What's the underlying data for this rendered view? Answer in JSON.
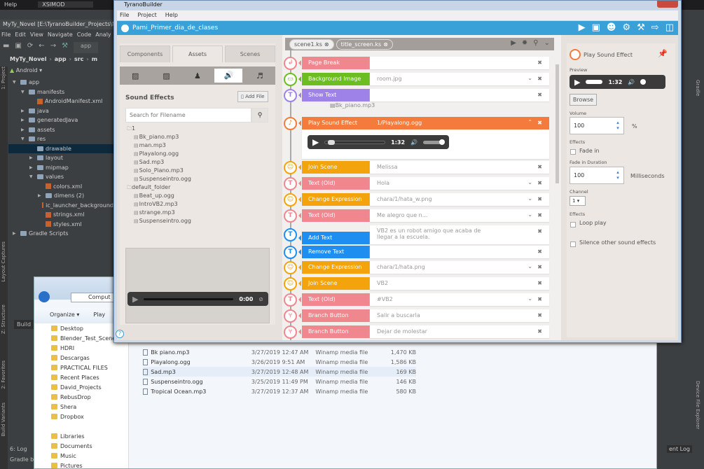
{
  "android_studio": {
    "top_menu": "Help",
    "top_tab": "XSIMOD",
    "title": "MyTy_Novel [E:\\TyranoBuilder_Projects\\M",
    "menu": [
      "File",
      "Edit",
      "View",
      "Navigate",
      "Code",
      "Analy"
    ],
    "run_config": "app",
    "breadcrumb": [
      "MyTy_Novel",
      "app",
      "src",
      "m"
    ],
    "view_selector": "Android",
    "side_tabs": [
      "1: Project",
      "Layout Captures",
      "Z: Structure",
      "2: Favorites",
      "Build Variants"
    ],
    "tree": [
      {
        "label": "app",
        "depth": 0,
        "arrow": "▼",
        "type": "folder"
      },
      {
        "label": "manifests",
        "depth": 1,
        "arrow": "▼",
        "type": "folder"
      },
      {
        "label": "AndroidManifest.xml",
        "depth": 2,
        "arrow": "",
        "type": "xml"
      },
      {
        "label": "java",
        "depth": 1,
        "arrow": "▶",
        "type": "folder"
      },
      {
        "label": "generatedJava",
        "depth": 1,
        "arrow": "▶",
        "type": "folder"
      },
      {
        "label": "assets",
        "depth": 1,
        "arrow": "▶",
        "type": "folder"
      },
      {
        "label": "res",
        "depth": 1,
        "arrow": "▼",
        "type": "folder"
      },
      {
        "label": "drawable",
        "depth": 2,
        "arrow": "",
        "type": "folder",
        "selected": true
      },
      {
        "label": "layout",
        "depth": 2,
        "arrow": "▶",
        "type": "folder"
      },
      {
        "label": "mipmap",
        "depth": 2,
        "arrow": "▶",
        "type": "folder"
      },
      {
        "label": "values",
        "depth": 2,
        "arrow": "▼",
        "type": "folder"
      },
      {
        "label": "colors.xml",
        "depth": 3,
        "arrow": "",
        "type": "xml"
      },
      {
        "label": "dimens (2)",
        "depth": 3,
        "arrow": "▶",
        "type": "folder"
      },
      {
        "label": "ic_launcher_background",
        "depth": 3,
        "arrow": "",
        "type": "xml"
      },
      {
        "label": "strings.xml",
        "depth": 3,
        "arrow": "",
        "type": "xml"
      },
      {
        "label": "styles.xml",
        "depth": 3,
        "arrow": "",
        "type": "xml"
      },
      {
        "label": "Gradle Scripts",
        "depth": 0,
        "arrow": "▶",
        "type": "folder"
      }
    ],
    "build_tab": "Build",
    "bottom_tabs": [
      "6: Log",
      "Gradle b"
    ],
    "right_tabs": [
      "Gradle",
      "Device File Explorer"
    ],
    "event_log": "ent Log"
  },
  "explorer": {
    "address": "Comput",
    "organize": "Organize ▾",
    "play": "Play",
    "sidebar": [
      "Desktop",
      "Blender_Test_Scene",
      "HDRI",
      "Descargas",
      "PRACTICAL FILES",
      "Recent Places",
      "David_Projects",
      "RebusDrop",
      "Shera",
      "Dropbox",
      "",
      "Libraries",
      "Documents",
      "Music",
      "Pictures"
    ],
    "files": [
      {
        "name": "Bk piano.mp3",
        "date": "3/27/2019 12:47 AM",
        "type": "Winamp media file",
        "size": "1,470 KB"
      },
      {
        "name": "Playalong.ogg",
        "date": "3/26/2019 9:51 AM",
        "type": "Winamp media file",
        "size": "1,586 KB"
      },
      {
        "name": "Sad.mp3",
        "date": "3/27/2019 12:48 AM",
        "type": "Winamp media file",
        "size": "169 KB",
        "selected": true
      },
      {
        "name": "Suspenseintro.ogg",
        "date": "3/25/2019 11:49 PM",
        "type": "Winamp media file",
        "size": "146 KB"
      },
      {
        "name": "Tropical Ocean.mp3",
        "date": "3/27/2019 12:37 AM",
        "type": "Winamp media file",
        "size": "580 KB"
      }
    ]
  },
  "tyrano": {
    "window_title": "TyranoBuilder",
    "menu": [
      "File",
      "Project",
      "Help"
    ],
    "project_name": "Pami_Primer_dia_de_clases",
    "left": {
      "tabs": [
        "Components",
        "Assets",
        "Scenes"
      ],
      "active_tab": "Assets",
      "section_title": "Sound Effects",
      "add_file": "Add File",
      "search_placeholder": "Search for Filename",
      "folders": [
        {
          "name": "1",
          "files": [
            "Bk_piano.mp3",
            "man.mp3",
            "Playalong.ogg",
            "Sad.mp3",
            "Solo_Piano.mp3",
            "Suspenseintro.ogg"
          ]
        },
        {
          "name": "default_folder",
          "files": [
            "Beat_up.ogg",
            "IntroVB2.mp3",
            "strange.mp3",
            "Suspenseintro.ogg"
          ]
        }
      ],
      "preview_time": "0:00"
    },
    "scene_tabs": [
      "scene1.ks",
      "title_screen.ks"
    ],
    "drag_ghost": "Bk_piano.mp3",
    "colors": {
      "pink": "#f0878f",
      "green": "#6cbd1f",
      "purple": "#9f82e8",
      "orange": "#f47b3c",
      "amber": "#f3a30c",
      "blue": "#1e8ef0",
      "header": "#3aa0d8"
    },
    "rows": [
      {
        "label": "Page Break",
        "value": "",
        "color": "pink",
        "glyph": "↲",
        "chev": false
      },
      {
        "label": "Background Image",
        "value": "room.jpg",
        "color": "green",
        "glyph": "▭",
        "chev": true
      },
      {
        "label": "Show Text",
        "value": "",
        "color": "purple",
        "glyph": "T",
        "chev": false
      },
      {
        "label": "Play Sound Effect",
        "value": "1/Playalong.ogg",
        "color": "orange",
        "glyph": "♪",
        "expanded": true
      },
      {
        "label": "Join Scene",
        "value": "Melissa",
        "color": "amber",
        "glyph": "☺",
        "chev": false
      },
      {
        "label": "Text (Old)",
        "value": "Hola",
        "color": "pink",
        "glyph": "T",
        "chev": true
      },
      {
        "label": "Change Expression",
        "value": "chara/1/hata_w.png",
        "color": "amber",
        "glyph": "☺",
        "chev": true
      },
      {
        "label": "Text (Old)",
        "value": "Me alegro que n...",
        "color": "pink",
        "glyph": "T",
        "chev": true
      },
      {
        "label": "Add Text",
        "value": "VB2 es un robot amigo que acaba de llegar a la escuela.",
        "color": "blue",
        "glyph": "T",
        "chev": false,
        "tall": true
      },
      {
        "label": "Remove Text",
        "value": "",
        "color": "blue",
        "glyph": "T",
        "chev": false
      },
      {
        "label": "Change Expression",
        "value": "chara/1/hata.png",
        "color": "amber",
        "glyph": "☺",
        "chev": true
      },
      {
        "label": "Join Scene",
        "value": "VB2",
        "color": "amber",
        "glyph": "☺",
        "chev": false
      },
      {
        "label": "Text (Old)",
        "value": "#VB2",
        "color": "pink",
        "glyph": "T",
        "chev": true
      },
      {
        "label": "Branch Button",
        "value": "Salir a buscarla",
        "color": "pink",
        "glyph": "⑂",
        "chev": false
      },
      {
        "label": "Branch Button",
        "value": "Dejar de molestar",
        "color": "pink",
        "glyph": "⑂",
        "chev": false
      }
    ],
    "player_time": "1:32",
    "player_progress": 0.05,
    "player_volume": 0.9,
    "right": {
      "title": "Play Sound Effect",
      "preview_label": "Preview",
      "preview_time": "1:32",
      "browse": "Browse",
      "volume_label": "Volume",
      "volume": "100",
      "volume_unit": "%",
      "effects_label": "Effects",
      "fade_in": "Fade in",
      "fade_in_checked": false,
      "fade_duration_label": "Fade in Duration",
      "fade_duration": "100",
      "fade_unit": "Milliseconds",
      "channel_label": "Channel",
      "channel": "1",
      "effects_label2": "Effects",
      "loop_play": "Loop play",
      "loop_checked": false,
      "silence": "Silence other sound effects",
      "silence_checked": false
    }
  }
}
